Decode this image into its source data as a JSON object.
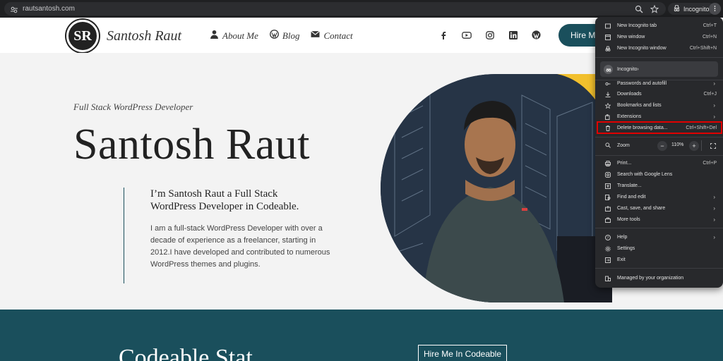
{
  "browser": {
    "url": "rautsantosh.com",
    "incognito_label": "Incognito"
  },
  "site": {
    "brand": "Santosh Raut",
    "logo_text": "SR",
    "nav": [
      "About Me",
      "Blog",
      "Contact"
    ],
    "socials": [
      "facebook-icon",
      "youtube-icon",
      "instagram-icon",
      "linkedin-icon",
      "wordpress-icon"
    ],
    "hire_label": "Hire Me",
    "accent": "#1a4f5c"
  },
  "hero": {
    "subtitle": "Full Stack WordPress Developer",
    "title": "Santosh Raut",
    "intro": "I’m Santosh Raut a Full Stack WordPress Developer in Codeable.",
    "description": "I am a full-stack WordPress Developer with over a decade of experience as a freelancer, starting in 2012.I have developed and contributed to numerous WordPress themes and plugins."
  },
  "band": {
    "title": "Codeable Stat",
    "button": "Hire Me In Codeable"
  },
  "menu": {
    "items": [
      {
        "label": "New Incognito tab",
        "shortcut": "Ctrl+T"
      },
      {
        "label": "New window",
        "shortcut": "Ctrl+N"
      },
      {
        "label": "New Incognito window",
        "shortcut": "Ctrl+Shift+N"
      },
      {
        "label": "Incognito"
      },
      {
        "label": "Passwords and autofill"
      },
      {
        "label": "Downloads",
        "shortcut": "Ctrl+J"
      },
      {
        "label": "Bookmarks and lists"
      },
      {
        "label": "Extensions"
      },
      {
        "label": "Delete browsing data...",
        "shortcut": "Ctrl+Shift+Del"
      },
      {
        "label": "Zoom",
        "value": "110%"
      },
      {
        "label": "Print...",
        "shortcut": "Ctrl+P"
      },
      {
        "label": "Search with Google Lens"
      },
      {
        "label": "Translate..."
      },
      {
        "label": "Find and edit"
      },
      {
        "label": "Cast, save, and share"
      },
      {
        "label": "More tools"
      },
      {
        "label": "Help"
      },
      {
        "label": "Settings"
      },
      {
        "label": "Exit"
      },
      {
        "label": "Managed by your organization"
      }
    ],
    "highlight_color": "#e00000"
  }
}
